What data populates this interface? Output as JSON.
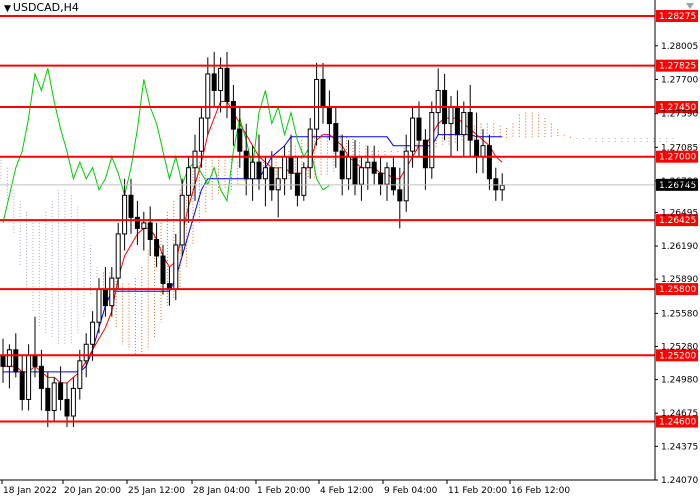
{
  "header": {
    "symbol": "USDCAD,H4",
    "menu_icon": "dropdown-triangle-icon"
  },
  "colors": {
    "background": "#ffffff",
    "level_line": "#ff0000",
    "candle": "#000000",
    "tenkan": "#ff0000",
    "kijun": "#0000ff",
    "chikou": "#00cc00",
    "cloud_bull": "#d2691e",
    "cloud_bear": "#b0a0c8",
    "current_price_bg": "#000000",
    "level_label_bg": "#ff0000"
  },
  "chart_data": {
    "type": "candlestick",
    "title": "USDCAD,H4",
    "ylim": [
      1.2407,
      1.2842
    ],
    "y_ticks": [
      "1.28005",
      "1.27700",
      "1.27390",
      "1.27085",
      "1.26780",
      "1.26495",
      "1.26190",
      "1.25890",
      "1.25580",
      "1.25280",
      "1.24980",
      "1.24675",
      "1.24375",
      "1.24070"
    ],
    "x_ticks": [
      "18 Jan 2022",
      "20 Jan 20:00",
      "25 Jan 12:00",
      "28 Jan 04:00",
      "1 Feb 20:00",
      "4 Feb 12:00",
      "9 Feb 04:00",
      "11 Feb 20:00",
      "16 Feb 12:00"
    ],
    "levels": [
      "1.28275",
      "1.27825",
      "1.27450",
      "1.27000",
      "1.26425",
      "1.25800",
      "1.25200",
      "1.24600"
    ],
    "current_price": "1.26745",
    "grid": false,
    "indicators": [
      "Ichimoku Kinko Hyo"
    ],
    "candles": [
      {
        "o": 1.252,
        "h": 1.2535,
        "l": 1.2495,
        "c": 1.251
      },
      {
        "o": 1.251,
        "h": 1.253,
        "l": 1.249,
        "c": 1.2525
      },
      {
        "o": 1.2525,
        "h": 1.254,
        "l": 1.25,
        "c": 1.2505
      },
      {
        "o": 1.2505,
        "h": 1.252,
        "l": 1.247,
        "c": 1.248
      },
      {
        "o": 1.248,
        "h": 1.253,
        "l": 1.247,
        "c": 1.252
      },
      {
        "o": 1.252,
        "h": 1.2555,
        "l": 1.25,
        "c": 1.251
      },
      {
        "o": 1.251,
        "h": 1.2525,
        "l": 1.247,
        "c": 1.249
      },
      {
        "o": 1.249,
        "h": 1.2505,
        "l": 1.2455,
        "c": 1.247
      },
      {
        "o": 1.247,
        "h": 1.25,
        "l": 1.246,
        "c": 1.2495
      },
      {
        "o": 1.2495,
        "h": 1.251,
        "l": 1.247,
        "c": 1.248
      },
      {
        "o": 1.248,
        "h": 1.2495,
        "l": 1.2455,
        "c": 1.2465
      },
      {
        "o": 1.2465,
        "h": 1.25,
        "l": 1.2455,
        "c": 1.249
      },
      {
        "o": 1.249,
        "h": 1.2525,
        "l": 1.248,
        "c": 1.2515
      },
      {
        "o": 1.2515,
        "h": 1.254,
        "l": 1.25,
        "c": 1.253
      },
      {
        "o": 1.253,
        "h": 1.256,
        "l": 1.2515,
        "c": 1.255
      },
      {
        "o": 1.255,
        "h": 1.259,
        "l": 1.254,
        "c": 1.258
      },
      {
        "o": 1.258,
        "h": 1.26,
        "l": 1.2555,
        "c": 1.2565
      },
      {
        "o": 1.2565,
        "h": 1.26,
        "l": 1.2555,
        "c": 1.259
      },
      {
        "o": 1.259,
        "h": 1.264,
        "l": 1.258,
        "c": 1.263
      },
      {
        "o": 1.263,
        "h": 1.268,
        "l": 1.2615,
        "c": 1.2665
      },
      {
        "o": 1.2665,
        "h": 1.268,
        "l": 1.263,
        "c": 1.2645
      },
      {
        "o": 1.2645,
        "h": 1.266,
        "l": 1.262,
        "c": 1.2635
      },
      {
        "o": 1.2635,
        "h": 1.265,
        "l": 1.2615,
        "c": 1.264
      },
      {
        "o": 1.264,
        "h": 1.2655,
        "l": 1.261,
        "c": 1.2625
      },
      {
        "o": 1.2625,
        "h": 1.264,
        "l": 1.26,
        "c": 1.261
      },
      {
        "o": 1.261,
        "h": 1.262,
        "l": 1.2575,
        "c": 1.2585
      },
      {
        "o": 1.2585,
        "h": 1.26,
        "l": 1.2565,
        "c": 1.258
      },
      {
        "o": 1.258,
        "h": 1.263,
        "l": 1.257,
        "c": 1.262
      },
      {
        "o": 1.262,
        "h": 1.268,
        "l": 1.261,
        "c": 1.2665
      },
      {
        "o": 1.2665,
        "h": 1.27,
        "l": 1.264,
        "c": 1.269
      },
      {
        "o": 1.269,
        "h": 1.272,
        "l": 1.266,
        "c": 1.2705
      },
      {
        "o": 1.2705,
        "h": 1.2745,
        "l": 1.269,
        "c": 1.2735
      },
      {
        "o": 1.2735,
        "h": 1.279,
        "l": 1.272,
        "c": 1.2775
      },
      {
        "o": 1.2775,
        "h": 1.2795,
        "l": 1.2745,
        "c": 1.276
      },
      {
        "o": 1.276,
        "h": 1.279,
        "l": 1.274,
        "c": 1.278
      },
      {
        "o": 1.278,
        "h": 1.2795,
        "l": 1.2735,
        "c": 1.275
      },
      {
        "o": 1.275,
        "h": 1.2765,
        "l": 1.271,
        "c": 1.2725
      },
      {
        "o": 1.2725,
        "h": 1.2745,
        "l": 1.269,
        "c": 1.2705
      },
      {
        "o": 1.2705,
        "h": 1.273,
        "l": 1.2665,
        "c": 1.268
      },
      {
        "o": 1.268,
        "h": 1.271,
        "l": 1.266,
        "c": 1.2695
      },
      {
        "o": 1.2695,
        "h": 1.272,
        "l": 1.267,
        "c": 1.268
      },
      {
        "o": 1.268,
        "h": 1.27,
        "l": 1.2655,
        "c": 1.269
      },
      {
        "o": 1.269,
        "h": 1.2705,
        "l": 1.266,
        "c": 1.267
      },
      {
        "o": 1.267,
        "h": 1.269,
        "l": 1.2645,
        "c": 1.268
      },
      {
        "o": 1.268,
        "h": 1.271,
        "l": 1.2665,
        "c": 1.27
      },
      {
        "o": 1.27,
        "h": 1.272,
        "l": 1.267,
        "c": 1.2685
      },
      {
        "o": 1.2685,
        "h": 1.27,
        "l": 1.2655,
        "c": 1.2665
      },
      {
        "o": 1.2665,
        "h": 1.2695,
        "l": 1.266,
        "c": 1.269
      },
      {
        "o": 1.269,
        "h": 1.2735,
        "l": 1.268,
        "c": 1.2725
      },
      {
        "o": 1.2725,
        "h": 1.2785,
        "l": 1.271,
        "c": 1.277
      },
      {
        "o": 1.277,
        "h": 1.2785,
        "l": 1.273,
        "c": 1.2745
      },
      {
        "o": 1.2745,
        "h": 1.276,
        "l": 1.2715,
        "c": 1.273
      },
      {
        "o": 1.273,
        "h": 1.2745,
        "l": 1.269,
        "c": 1.2705
      },
      {
        "o": 1.2705,
        "h": 1.272,
        "l": 1.2665,
        "c": 1.268
      },
      {
        "o": 1.268,
        "h": 1.2715,
        "l": 1.267,
        "c": 1.27
      },
      {
        "o": 1.27,
        "h": 1.2715,
        "l": 1.2665,
        "c": 1.2675
      },
      {
        "o": 1.2675,
        "h": 1.27,
        "l": 1.266,
        "c": 1.269
      },
      {
        "o": 1.269,
        "h": 1.271,
        "l": 1.267,
        "c": 1.2695
      },
      {
        "o": 1.2695,
        "h": 1.271,
        "l": 1.2675,
        "c": 1.2685
      },
      {
        "o": 1.2685,
        "h": 1.27,
        "l": 1.2665,
        "c": 1.2675
      },
      {
        "o": 1.2675,
        "h": 1.2695,
        "l": 1.266,
        "c": 1.269
      },
      {
        "o": 1.269,
        "h": 1.27,
        "l": 1.2665,
        "c": 1.267
      },
      {
        "o": 1.267,
        "h": 1.269,
        "l": 1.2635,
        "c": 1.266
      },
      {
        "o": 1.266,
        "h": 1.272,
        "l": 1.265,
        "c": 1.2705
      },
      {
        "o": 1.2705,
        "h": 1.2745,
        "l": 1.269,
        "c": 1.2735
      },
      {
        "o": 1.2735,
        "h": 1.275,
        "l": 1.27,
        "c": 1.2715
      },
      {
        "o": 1.2715,
        "h": 1.2725,
        "l": 1.267,
        "c": 1.269
      },
      {
        "o": 1.269,
        "h": 1.275,
        "l": 1.268,
        "c": 1.274
      },
      {
        "o": 1.274,
        "h": 1.278,
        "l": 1.272,
        "c": 1.276
      },
      {
        "o": 1.276,
        "h": 1.2775,
        "l": 1.2715,
        "c": 1.273
      },
      {
        "o": 1.273,
        "h": 1.2755,
        "l": 1.27,
        "c": 1.2745
      },
      {
        "o": 1.2745,
        "h": 1.276,
        "l": 1.2705,
        "c": 1.272
      },
      {
        "o": 1.272,
        "h": 1.275,
        "l": 1.27,
        "c": 1.274
      },
      {
        "o": 1.274,
        "h": 1.2765,
        "l": 1.27,
        "c": 1.2715
      },
      {
        "o": 1.2715,
        "h": 1.274,
        "l": 1.2685,
        "c": 1.27
      },
      {
        "o": 1.27,
        "h": 1.2725,
        "l": 1.2685,
        "c": 1.271
      },
      {
        "o": 1.271,
        "h": 1.272,
        "l": 1.267,
        "c": 1.268
      },
      {
        "o": 1.268,
        "h": 1.269,
        "l": 1.266,
        "c": 1.267
      },
      {
        "o": 1.267,
        "h": 1.2685,
        "l": 1.266,
        "c": 1.2674
      }
    ],
    "series": [
      {
        "name": "Tenkan-sen",
        "values": [
          1.251,
          1.251,
          1.251,
          1.2505,
          1.2505,
          1.251,
          1.2505,
          1.25,
          1.25,
          1.2495,
          1.2495,
          1.25,
          1.2505,
          1.2515,
          1.2525,
          1.2535,
          1.2545,
          1.256,
          1.259,
          1.261,
          1.262,
          1.263,
          1.2635,
          1.2635,
          1.2625,
          1.261,
          1.26,
          1.2605,
          1.263,
          1.2655,
          1.2675,
          1.2695,
          1.272,
          1.2735,
          1.275,
          1.275,
          1.274,
          1.273,
          1.272,
          1.271,
          1.27,
          1.2695,
          1.269,
          1.269,
          1.269,
          1.2685,
          1.2685,
          1.2685,
          1.2695,
          1.2715,
          1.272,
          1.272,
          1.2715,
          1.271,
          1.27,
          1.2695,
          1.269,
          1.269,
          1.269,
          1.2685,
          1.2685,
          1.268,
          1.268,
          1.269,
          1.27,
          1.271,
          1.271,
          1.272,
          1.273,
          1.2735,
          1.2735,
          1.2735,
          1.273,
          1.2725,
          1.272,
          1.2715,
          1.271,
          1.27,
          1.2695
        ]
      },
      {
        "name": "Kijun-sen",
        "values": [
          1.2505,
          1.2505,
          1.2505,
          1.2505,
          1.2505,
          1.2505,
          1.2505,
          1.2505,
          1.2505,
          1.2505,
          1.2505,
          1.2505,
          1.2505,
          1.251,
          1.2525,
          1.2545,
          1.2565,
          1.2578,
          1.2578,
          1.2578,
          1.2578,
          1.2578,
          1.2578,
          1.2578,
          1.2578,
          1.2578,
          1.2578,
          1.259,
          1.261,
          1.263,
          1.265,
          1.267,
          1.268,
          1.268,
          1.268,
          1.268,
          1.268,
          1.268,
          1.268,
          1.268,
          1.268,
          1.269,
          1.27,
          1.2705,
          1.271,
          1.2718,
          1.2718,
          1.2718,
          1.2718,
          1.2718,
          1.2718,
          1.2718,
          1.2718,
          1.2718,
          1.2718,
          1.2718,
          1.2718,
          1.2718,
          1.2718,
          1.2718,
          1.2718,
          1.271,
          1.271,
          1.271,
          1.271,
          1.271,
          1.271,
          1.271,
          1.272,
          1.272,
          1.272,
          1.272,
          1.272,
          1.272,
          1.2718,
          1.2718,
          1.2718,
          1.2718,
          1.2718
        ]
      },
      {
        "name": "Chikou Span",
        "values": [
          1.264,
          1.2665,
          1.269,
          1.2705,
          1.2735,
          1.2775,
          1.276,
          1.278,
          1.275,
          1.2725,
          1.2705,
          1.268,
          1.2695,
          1.268,
          1.269,
          1.267,
          1.268,
          1.27,
          1.2685,
          1.2665,
          1.269,
          1.2725,
          1.277,
          1.2745,
          1.273,
          1.2705,
          1.268,
          1.27,
          1.2675,
          1.269,
          1.2695,
          1.2685,
          1.2675,
          1.269,
          1.267,
          1.266,
          1.2705,
          1.2735,
          1.2715,
          1.269,
          1.274,
          1.276,
          1.273,
          1.2745,
          1.272,
          1.274,
          1.2715,
          1.27,
          1.271,
          1.268,
          1.267,
          1.2674
        ]
      },
      {
        "name": "Senkou Span A",
        "values": [
          1.268,
          1.266,
          1.263,
          1.26,
          1.258,
          1.256,
          1.2545,
          1.254,
          1.2535,
          1.253,
          1.253,
          1.253,
          1.254,
          1.2555,
          1.2575,
          1.259,
          1.2595,
          1.2595,
          1.259,
          1.2585,
          1.2585,
          1.259,
          1.26,
          1.2615,
          1.263,
          1.264,
          1.265,
          1.266,
          1.267,
          1.268,
          1.269,
          1.2695,
          1.27,
          1.27,
          1.27,
          1.27,
          1.2698,
          1.2695,
          1.2695,
          1.2695,
          1.2695,
          1.2695,
          1.2695,
          1.2698,
          1.27,
          1.2705,
          1.271,
          1.2715,
          1.2718,
          1.272,
          1.272,
          1.272,
          1.272,
          1.272,
          1.2718,
          1.2716,
          1.2713,
          1.271,
          1.2705,
          1.2705,
          1.2705,
          1.2705,
          1.2705,
          1.2708,
          1.271,
          1.2712,
          1.2714,
          1.2716,
          1.2718,
          1.272,
          1.272,
          1.2722,
          1.2724,
          1.2726,
          1.2728,
          1.273,
          1.273,
          1.273,
          1.2728,
          1.2726,
          1.273,
          1.2738,
          1.274,
          1.274,
          1.2738,
          1.2735,
          1.273,
          1.2725,
          1.272,
          1.2718,
          1.2716,
          1.2715,
          1.2714,
          1.2713,
          1.2712,
          1.2712,
          1.2712,
          1.2712,
          1.2712,
          1.2712,
          1.2712,
          1.2712,
          1.2712,
          1.2712,
          1.2712,
          1.2712
        ]
      },
      {
        "name": "Senkou Span B",
        "values": [
          1.27,
          1.269,
          1.267,
          1.266,
          1.265,
          1.264,
          1.264,
          1.265,
          1.266,
          1.267,
          1.267,
          1.2665,
          1.2655,
          1.264,
          1.262,
          1.26,
          1.258,
          1.2565,
          1.2545,
          1.253,
          1.2525,
          1.252,
          1.252,
          1.2525,
          1.2535,
          1.255,
          1.2565,
          1.257,
          1.258,
          1.26,
          1.262,
          1.264,
          1.265,
          1.266,
          1.2665,
          1.267,
          1.267,
          1.2675,
          1.2678,
          1.268,
          1.268,
          1.268,
          1.268,
          1.268,
          1.268,
          1.268,
          1.268,
          1.268,
          1.268,
          1.268,
          1.2682,
          1.2684,
          1.2686,
          1.2688,
          1.269,
          1.2692,
          1.2694,
          1.2696,
          1.2698,
          1.27,
          1.2701,
          1.2702,
          1.2703,
          1.2704,
          1.2705,
          1.2706,
          1.2707,
          1.2708,
          1.2709,
          1.271,
          1.2711,
          1.2712,
          1.2713,
          1.2714,
          1.2715,
          1.2716,
          1.2717,
          1.2717,
          1.2717,
          1.2717,
          1.2717,
          1.2717,
          1.2717,
          1.2717,
          1.2717,
          1.2717,
          1.2717,
          1.2717,
          1.2717,
          1.2717,
          1.2717,
          1.2717,
          1.2717,
          1.2717,
          1.2717,
          1.2717,
          1.2717,
          1.2717,
          1.2717,
          1.2717,
          1.2717,
          1.2717,
          1.2717,
          1.2717,
          1.2717,
          1.2717
        ]
      }
    ]
  }
}
